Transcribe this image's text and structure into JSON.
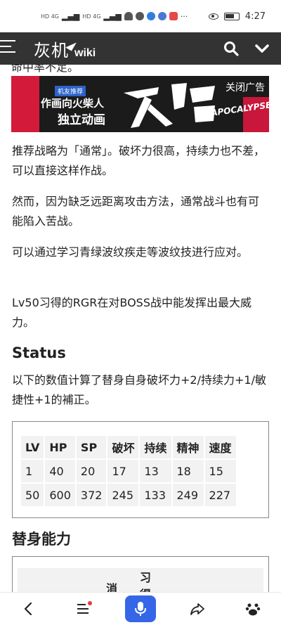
{
  "status_bar": {
    "signal_1": "HD 4G",
    "signal_2": "HD 4G",
    "time": "4:27"
  },
  "header": {
    "logo_text": "灰机",
    "logo_suffix": "wiki",
    "icons": [
      "menu-icon",
      "search-icon",
      "chevron-down-icon"
    ]
  },
  "content": {
    "cut_line": "命中率不足。",
    "ad": {
      "tag": "机友推荐",
      "line1": "作画向火柴人",
      "line2": "独立动画",
      "close_label": "关闭广告",
      "title_en": "APOCALYPSE"
    },
    "paragraphs": [
      "推荐战略为「通常」。破坏力很高，持续力也不差，可以直接这样作战。",
      "然而，因为缺乏远距离攻击方法，通常战斗也有可能陷入苦战。",
      "可以通过学习青绿波纹疾走等波纹技进行应对。",
      "Lv50习得的RGR在对BOSS战中能发挥出最大威力。"
    ],
    "status_heading": "Status",
    "status_note": "以下的数值计算了替身自身破坏力+2/持续力+1/敏捷性+1的補正。",
    "status_table": {
      "headers": [
        "LV",
        "HP",
        "SP",
        "破坏",
        "持续",
        "精神",
        "速度"
      ],
      "rows": [
        [
          "1",
          "40",
          "20",
          "17",
          "13",
          "18",
          "15"
        ],
        [
          "50",
          "600",
          "372",
          "245",
          "133",
          "249",
          "227"
        ]
      ]
    },
    "ability_heading": "替身能力",
    "ability_table_partial": {
      "col_a": "消",
      "col_b": "习得"
    }
  },
  "bottom_nav": {
    "icons": [
      "back-icon",
      "menu-list-icon",
      "mic-icon",
      "share-icon",
      "baidu-paw-icon"
    ]
  }
}
